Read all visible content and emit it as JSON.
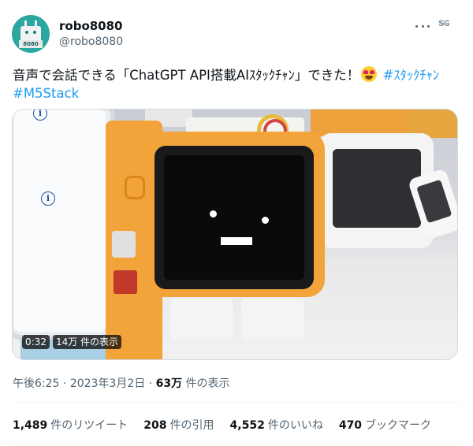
{
  "user": {
    "display_name": "robo8080",
    "handle": "@robo8080",
    "avatar_label": "8080"
  },
  "header_icons": [
    "more-icon",
    "tg-icon"
  ],
  "tg_glyph": "ꜱɢ",
  "tweet": {
    "text_main": "音声で会話できる「ChatGPT API搭載AIｽﾀｯｸﾁｬﾝ」できた！",
    "hashtag1": "#ｽﾀｯｸﾁｬﾝ",
    "hashtag2": "#M5Stack"
  },
  "media": {
    "duration": "0:32",
    "views": "14万 件の表示",
    "info_icon": "i"
  },
  "meta": {
    "time": "午後6:25",
    "sep": " · ",
    "date": "2023年3月2日",
    "views_count": "63万",
    "views_label": " 件の表示"
  },
  "stats": {
    "retweets_count": "1,489",
    "retweets_label": "件のリツイート",
    "quotes_count": "208",
    "quotes_label": "件の引用",
    "likes_count": "4,552",
    "likes_label": "件のいいね",
    "bookmarks_count": "470",
    "bookmarks_label": "ブックマーク"
  },
  "colors": {
    "accent": "#1d9bf0",
    "text": "#0f1419",
    "secondary": "#536471",
    "avatar_bg": "#2aa7a0",
    "device_orange": "#f2a33a"
  }
}
